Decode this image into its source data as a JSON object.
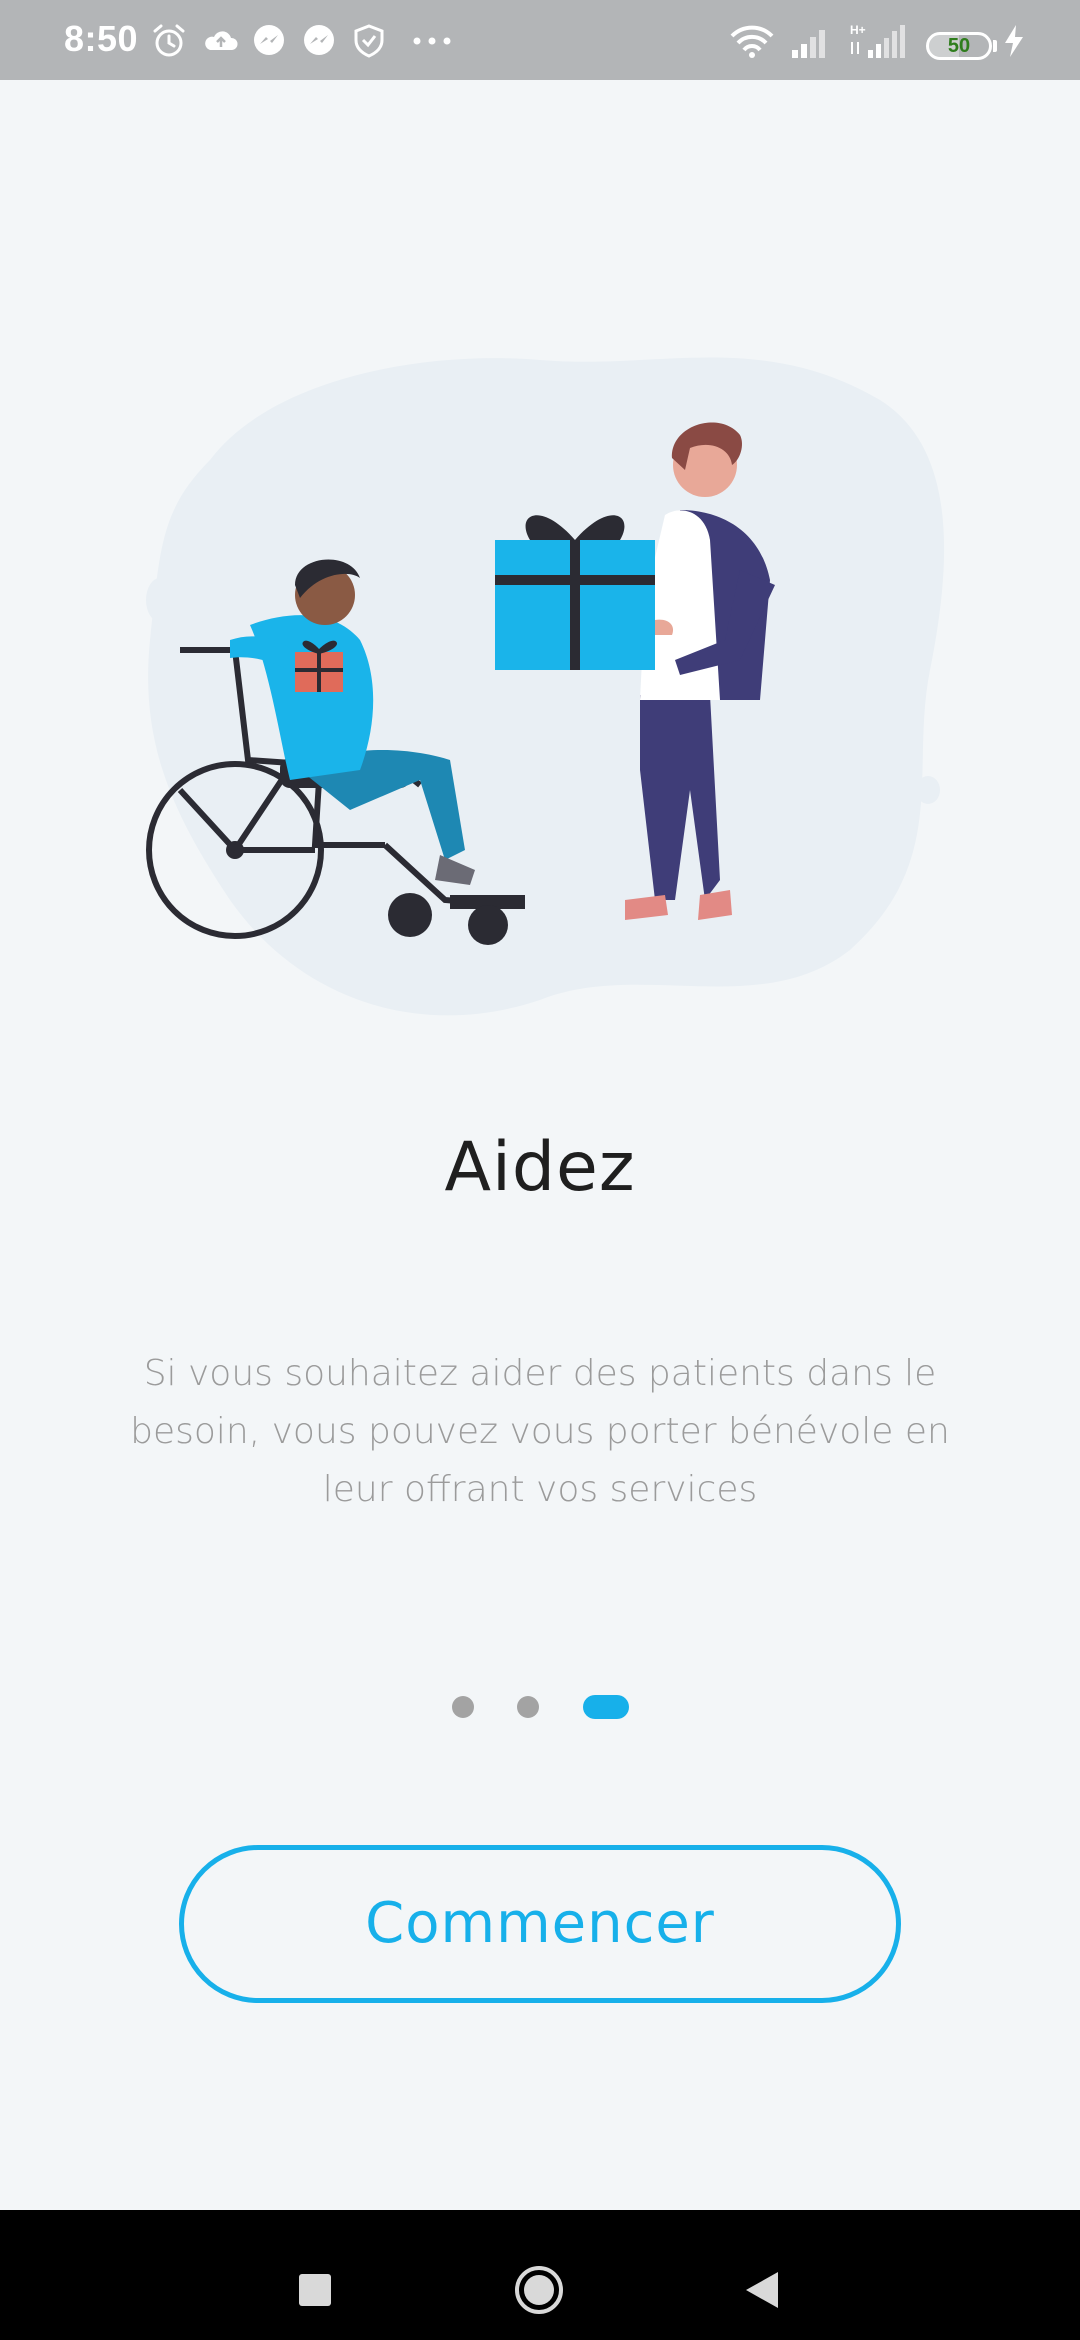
{
  "status_bar": {
    "time": "8:50",
    "icons": [
      "alarm-icon",
      "cloud-upload-icon",
      "messenger-icon",
      "messenger-icon",
      "shield-icon",
      "more-dots-icon",
      "wifi-icon",
      "signal-icon",
      "signal-h-plus-icon",
      "battery-icon",
      "charging-icon"
    ],
    "network_type": "H+",
    "battery_level": "50"
  },
  "onboarding": {
    "illustration": "volunteer-giving-gift-illustration",
    "title": "Aidez",
    "description": "Si vous souhaitez aider des patients dans le besoin, vous pouvez vous porter bénévole en leur offrant vos services",
    "page_indicator": {
      "total": 3,
      "active_index": 2
    },
    "start_button_label": "Commencer"
  },
  "colors": {
    "accent": "#17b0ea",
    "background": "#f3f6f8",
    "status_bar": "#b3b5b7",
    "text_title": "#1f1f1f",
    "text_body": "#9b9b9b"
  },
  "nav_bar": {
    "buttons": [
      "recents-icon",
      "home-icon",
      "back-icon"
    ]
  }
}
